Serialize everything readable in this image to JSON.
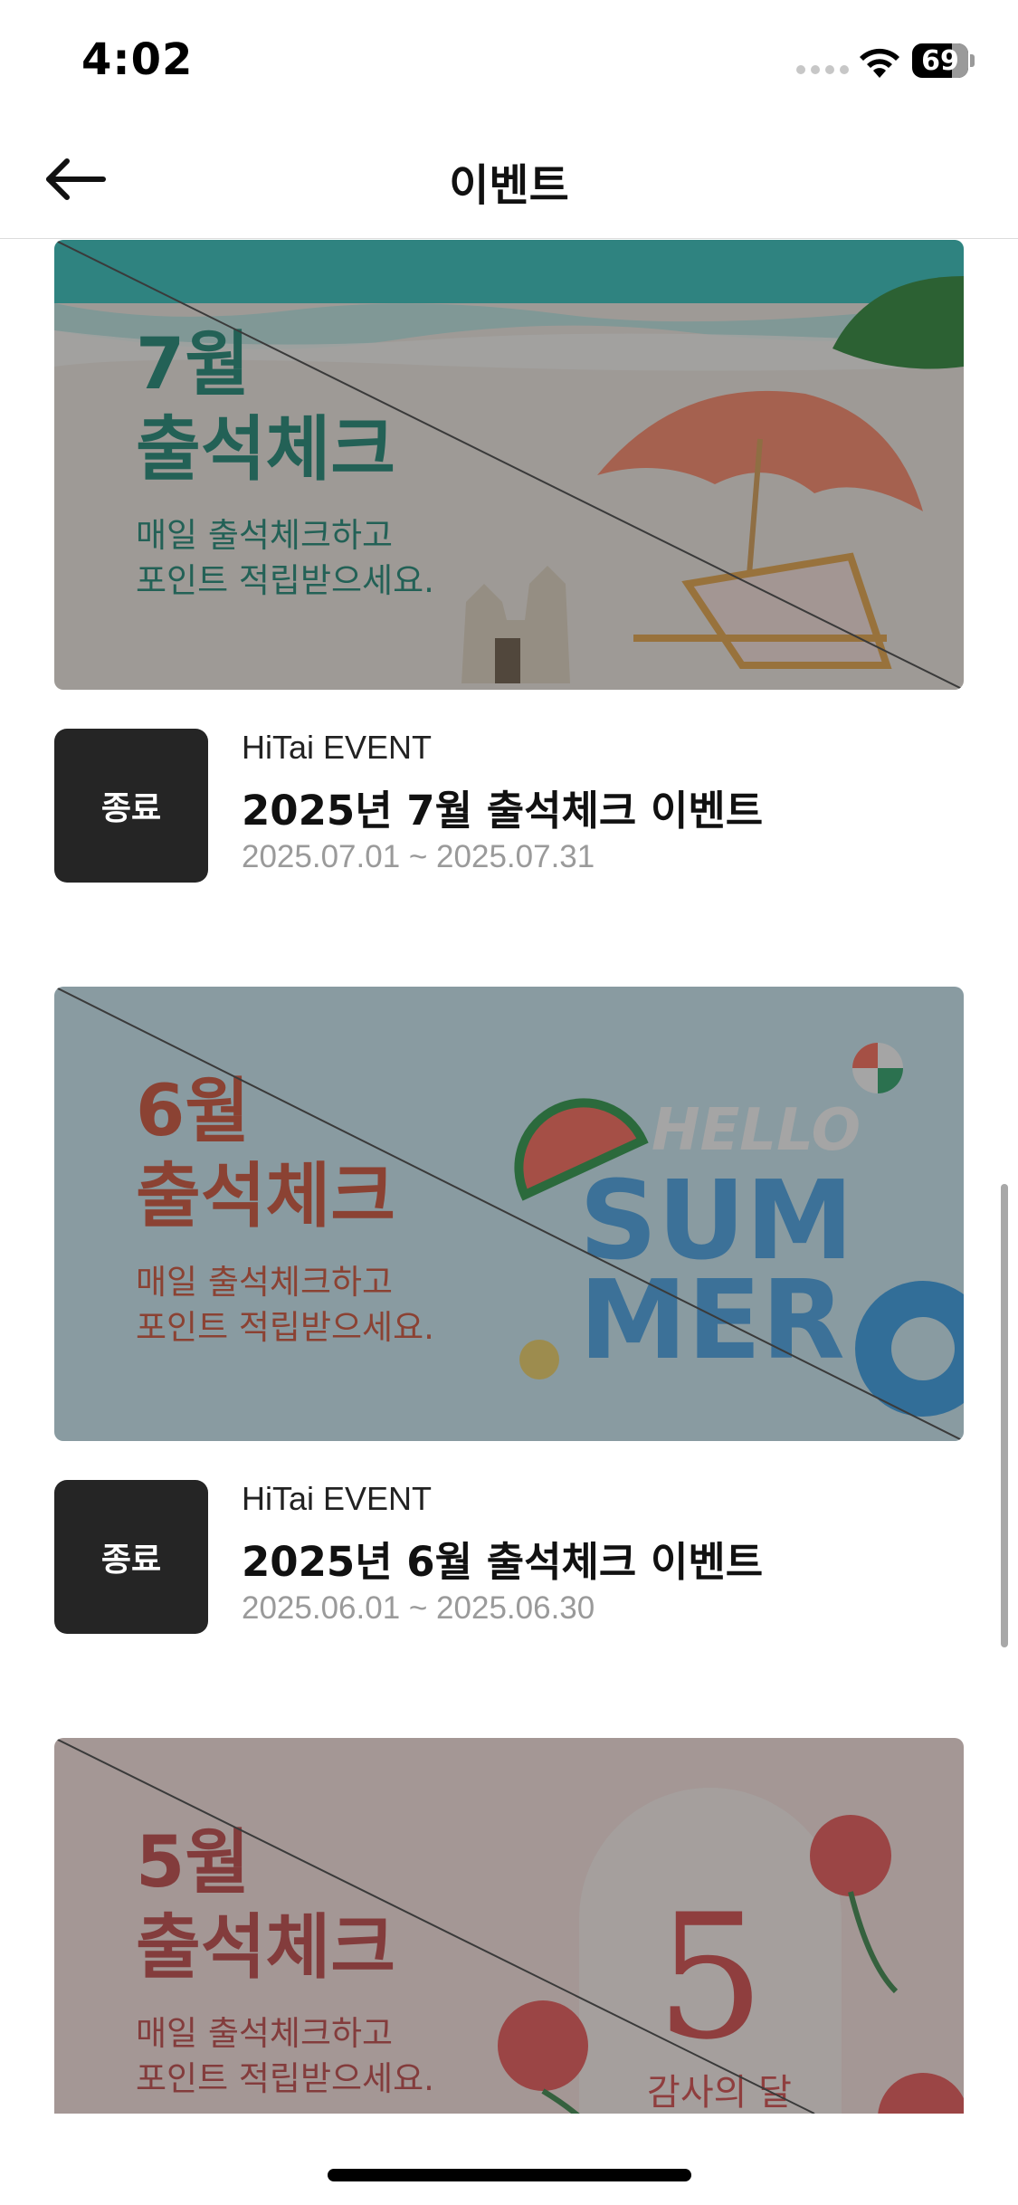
{
  "status_bar": {
    "time": "4:02",
    "battery": "69"
  },
  "nav": {
    "title": "이벤트"
  },
  "events": [
    {
      "banner": {
        "month": "7월",
        "title": "출석체크",
        "subtitle_1": "매일 출석체크하고",
        "subtitle_2": "포인트 적립받으세요."
      },
      "status": "종료",
      "org": "HiTai EVENT",
      "title": "2025년 7월 출석체크 이벤트",
      "period": "2025.07.01 ~ 2025.07.31"
    },
    {
      "banner": {
        "month": "6월",
        "title": "출석체크",
        "subtitle_1": "매일 출석체크하고",
        "subtitle_2": "포인트 적립받으세요.",
        "art_text": "HELLO SUM MER"
      },
      "status": "종료",
      "org": "HiTai EVENT",
      "title": "2025년 6월 출석체크 이벤트",
      "period": "2025.06.01 ~ 2025.06.30"
    },
    {
      "banner": {
        "month": "5월",
        "title": "출석체크",
        "subtitle_1": "매일 출석체크하고",
        "subtitle_2": "포인트 적립받으세요.",
        "art_number": "5",
        "art_caption": "감사의 달"
      }
    }
  ],
  "colors": {
    "badge_bg": "#252525",
    "banner_7_text": "#1f8a78",
    "banner_6_text": "#d2553c",
    "banner_5_text": "#c44a4a"
  }
}
